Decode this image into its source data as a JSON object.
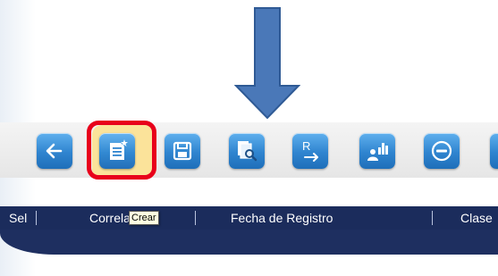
{
  "toolbar": {
    "buttons": [
      {
        "name": "back",
        "icon": "arrow-left-icon"
      },
      {
        "name": "create",
        "icon": "new-document-icon",
        "tooltip": "Crear"
      },
      {
        "name": "save",
        "icon": "floppy-disk-icon"
      },
      {
        "name": "search",
        "icon": "document-search-icon"
      },
      {
        "name": "report",
        "icon": "report-export-icon"
      },
      {
        "name": "statistics",
        "icon": "user-chart-icon"
      },
      {
        "name": "remove",
        "icon": "minus-circle-icon"
      }
    ]
  },
  "tooltip": {
    "text": "Crear"
  },
  "grid": {
    "columns": [
      "Sel",
      "Correlativo",
      "Fecha de Registro",
      "Clase"
    ]
  },
  "colors": {
    "accent": "#2f84cf",
    "highlight_ring": "#e8001b",
    "header_bg": "#1b2c5c",
    "arrow": "#4a78b8"
  }
}
